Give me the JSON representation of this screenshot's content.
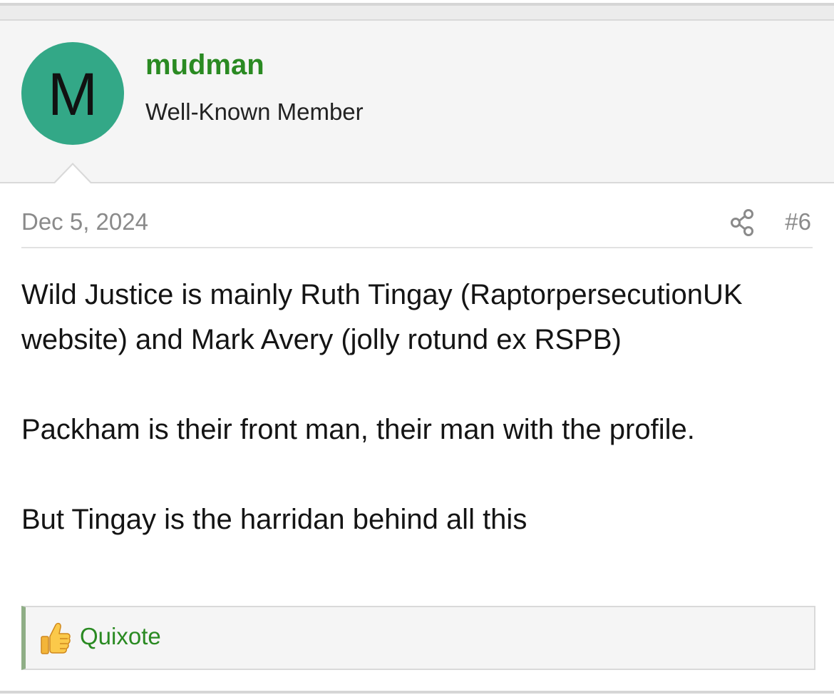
{
  "author": {
    "avatar_letter": "M",
    "avatar_color": "#33a887",
    "username": "mudman",
    "username_color": "#2a8a22",
    "title": "Well-Known Member"
  },
  "post": {
    "date": "Dec 5, 2024",
    "share_icon": "share-icon",
    "number": "#6",
    "paragraphs": [
      "Wild Justice is mainly Ruth Tingay (RaptorpersecutionUK website) and Mark Avery (jolly rotund ex RSPB)",
      "Packham is their front man, their man with the profile.",
      "But Tingay is the harridan behind all this"
    ]
  },
  "reactions": {
    "icon": "thumbs-up-icon",
    "users": "Quixote"
  }
}
